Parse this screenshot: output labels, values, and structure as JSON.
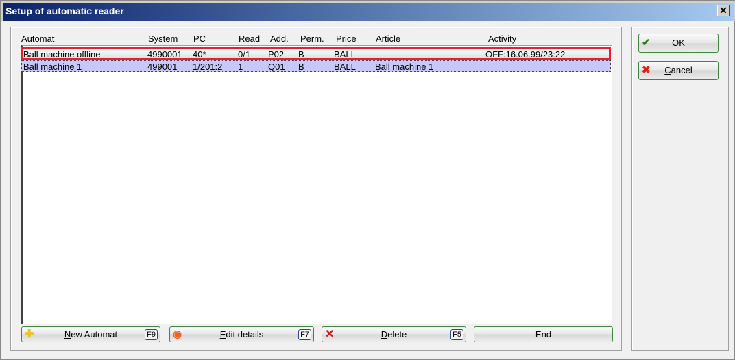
{
  "window": {
    "title": "Setup of automatic reader",
    "close": "✕"
  },
  "columns": [
    "Automat",
    "System",
    "PC",
    "Read",
    "Add.",
    "Perm.",
    "Price",
    "Article",
    "Activity"
  ],
  "rows": [
    [
      "Ball machine offline",
      "4990001",
      "40*",
      "0/1",
      "P02",
      "B",
      "BALL",
      "",
      "OFF:16.06.99/23:22"
    ],
    [
      "Ball machine 1",
      "499001",
      "1/201:2",
      "1",
      "Q01",
      "B",
      "BALL",
      "Ball machine 1",
      ""
    ]
  ],
  "buttons": {
    "new": {
      "u": "N",
      "rest": "ew Automat",
      "key": "F9"
    },
    "edit": {
      "u": "E",
      "rest": "dit details",
      "key": "F7"
    },
    "delete": {
      "u": "D",
      "rest": "elete",
      "key": "F5"
    },
    "end": "End",
    "ok": {
      "u": "O",
      "rest": "K"
    },
    "cancel": {
      "u": "C",
      "rest": "ancel"
    }
  }
}
